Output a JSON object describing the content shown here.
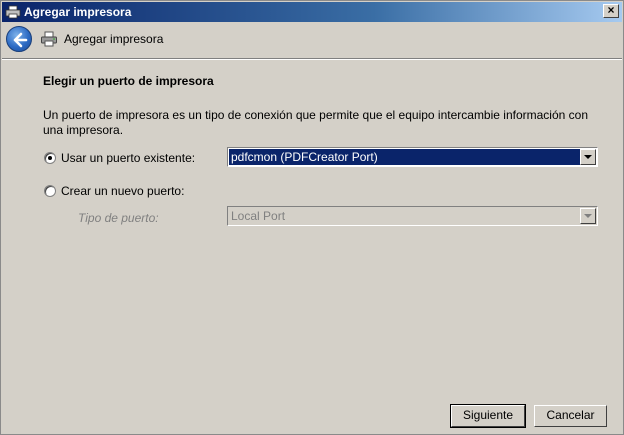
{
  "window": {
    "title": "Agregar impresora",
    "close_label": "×"
  },
  "header": {
    "title": "Agregar impresora",
    "back_icon": "back-arrow-icon",
    "printer_icon": "printer-icon"
  },
  "content": {
    "section_title": "Elegir un puerto de impresora",
    "description": "Un puerto de impresora es un tipo de conexión que permite que el equipo intercambie información con una impresora.",
    "existing_port": {
      "label": "Usar un puerto existente:",
      "selected": true,
      "value": "pdfcmon (PDFCreator Port)"
    },
    "new_port": {
      "label": "Crear un nuevo puerto:",
      "selected": false,
      "type_label": "Tipo de puerto:",
      "type_value": "Local Port"
    }
  },
  "buttons": {
    "next": "Siguiente",
    "cancel": "Cancelar"
  }
}
